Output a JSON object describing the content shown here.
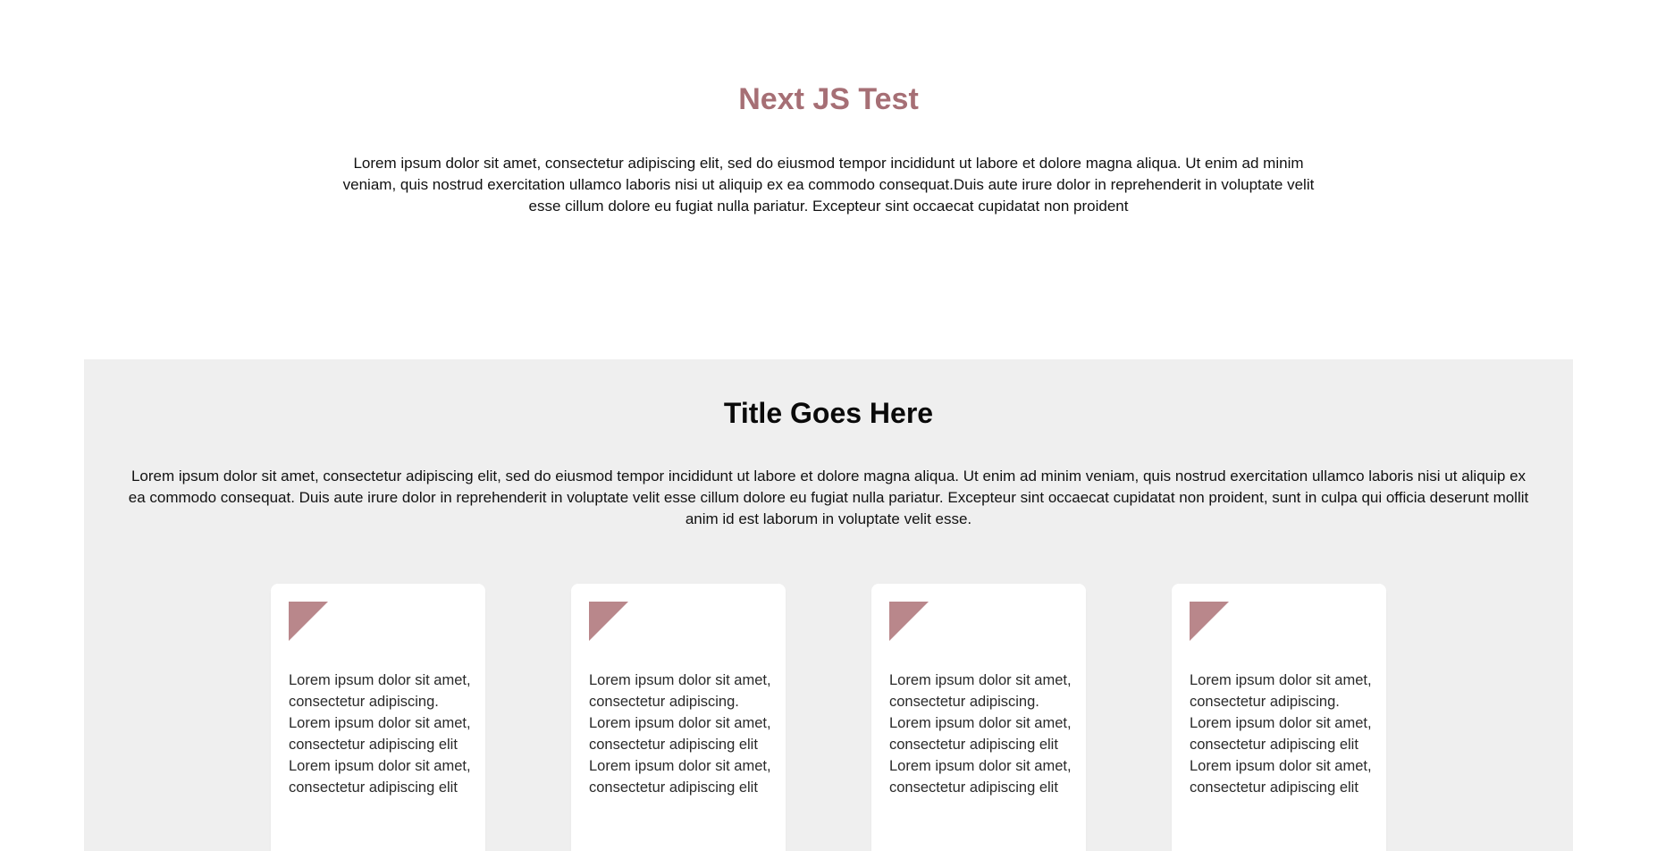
{
  "hero": {
    "title": "Next JS Test",
    "text": "Lorem ipsum dolor sit amet, consectetur adipiscing elit, sed do eiusmod tempor incididunt ut labore et dolore magna aliqua. Ut enim ad minim veniam, quis nostrud exercitation ullamco laboris nisi ut aliquip ex ea commodo consequat.Duis aute irure dolor in reprehenderit in voluptate velit esse cillum dolore eu fugiat nulla pariatur. Excepteur sint occaecat cupidatat non proident"
  },
  "section": {
    "title": "Title Goes Here",
    "text": "Lorem ipsum dolor sit amet, consectetur adipiscing elit, sed do eiusmod tempor incididunt ut labore et dolore magna aliqua. Ut enim ad minim veniam, quis nostrud exercitation ullamco laboris nisi ut aliquip ex ea commodo consequat. Duis aute irure dolor in reprehenderit in voluptate velit esse cillum dolore eu fugiat nulla pariatur. Excepteur sint occaecat cupidatat non proident, sunt in culpa qui officia deserunt mollit anim id est laborum in voluptate velit esse."
  },
  "cards": [
    {
      "icon": "triangle-icon",
      "text": "Lorem ipsum dolor sit amet, consectetur adipiscing. Lorem ipsum dolor sit amet, consectetur adipiscing elit Lorem ipsum dolor sit amet, consectetur adipiscing elit"
    },
    {
      "icon": "triangle-icon",
      "text": "Lorem ipsum dolor sit amet, consectetur adipiscing. Lorem ipsum dolor sit amet, consectetur adipiscing elit Lorem ipsum dolor sit amet, consectetur adipiscing elit"
    },
    {
      "icon": "triangle-icon",
      "text": "Lorem ipsum dolor sit amet, consectetur adipiscing. Lorem ipsum dolor sit amet, consectetur adipiscing elit Lorem ipsum dolor sit amet, consectetur adipiscing elit"
    },
    {
      "icon": "triangle-icon",
      "text": "Lorem ipsum dolor sit amet, consectetur adipiscing. Lorem ipsum dolor sit amet, consectetur adipiscing elit Lorem ipsum dolor sit amet, consectetur adipiscing elit"
    }
  ],
  "colors": {
    "accent": "#a66f75",
    "icon": "#b9878b",
    "section_background": "#efefef",
    "card_background": "#ffffff"
  }
}
